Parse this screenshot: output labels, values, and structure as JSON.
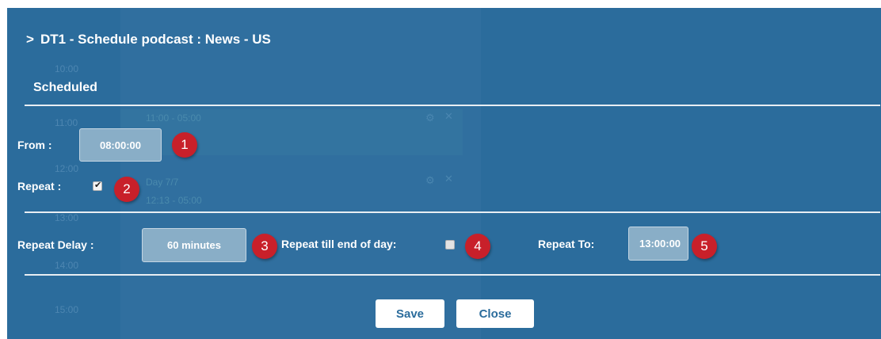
{
  "modal": {
    "title": "DT1 - Schedule podcast : News - US",
    "section": "Scheduled"
  },
  "background": {
    "hours": [
      "10:00",
      "11:00",
      "12:00",
      "13:00",
      "14:00",
      "15:00"
    ],
    "events": [
      "11:00 - 05:00",
      "Day 7/7",
      "12:13 - 05:00"
    ]
  },
  "form": {
    "from_label": "From :",
    "from_value": "08:00:00",
    "repeat_label": "Repeat :",
    "repeat_checked": true,
    "delay_label": "Repeat Delay :",
    "delay_value": "60 minutes",
    "end_of_day_label": "Repeat till end of day:",
    "end_of_day_checked": false,
    "repeat_to_label": "Repeat To:",
    "repeat_to_value": "13:00:00"
  },
  "badges": [
    "1",
    "2",
    "3",
    "4",
    "5"
  ],
  "buttons": {
    "save": "Save",
    "close": "Close"
  },
  "colors": {
    "modal_bg": "#2b6c9c",
    "badge": "#c8202a",
    "field_bg": "#89aec7"
  }
}
